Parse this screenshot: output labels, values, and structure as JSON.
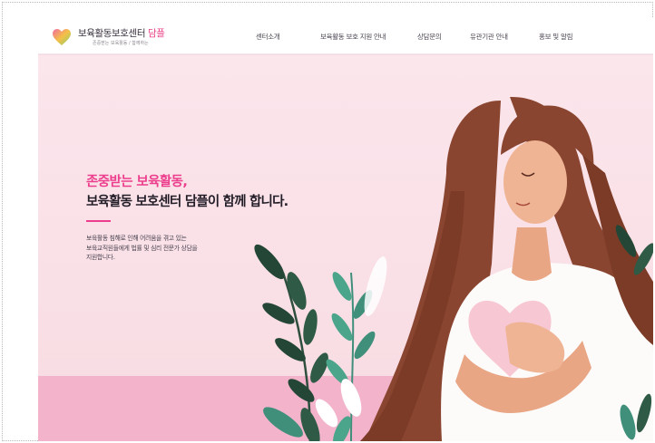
{
  "brand": {
    "name": "보육활동보호센터",
    "accent": "담플",
    "tagline": "존중받는 보육활동 / 함께하는",
    "colors": {
      "accent": "#ec3e8c",
      "hero": "#f7dbe2",
      "floor": "#f2b3cb"
    }
  },
  "nav": {
    "items": [
      {
        "label": "센터소개"
      },
      {
        "label": "보육활동 보호 지원 안내"
      },
      {
        "label": "상담문의"
      },
      {
        "label": "유관기관 안내"
      },
      {
        "label": "홍보 및 알림"
      }
    ]
  },
  "hero": {
    "headline_line1": "존중받는 보육활동,",
    "headline_line2": "보육활동 보호센터 담플이 함께 합니다.",
    "description": [
      "보육활동 침해로 인해 어려움을 겪고 있는",
      "보육교직원들에게 법률 및 심리 전문가 상담을",
      "지원합니다."
    ],
    "illustration": "woman-holding-heart-illustration"
  }
}
